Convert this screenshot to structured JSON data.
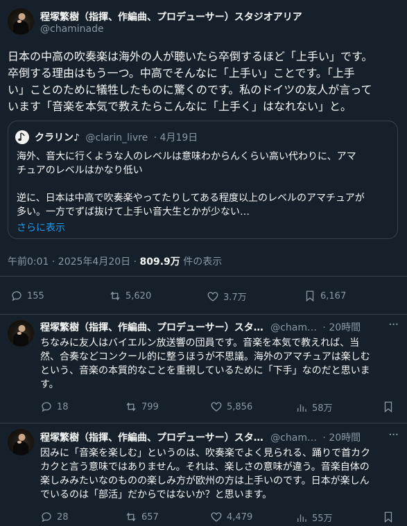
{
  "main_tweet": {
    "author_name": "程塚繁樹（指揮、作編曲、プロデューサー）スタジオアリア",
    "handle": "@chaminade",
    "lines": [
      "日本の中高の吹奏楽は海外の人が聴いたら卒倒するほど「上手い」です。",
      "卒倒する理由はもう一つ。中高でそんなに「上手い」ことです。「上手",
      "い」ことのために犠牲したものに驚くのです。私のドイツの友人が言って",
      "います「音楽を本気で教えたらこんなに「上手く」はなれない」と。"
    ],
    "quote": {
      "author_name": "クラリン♪",
      "handle": "@clarin_livre",
      "date": "· 4月19日",
      "lines": [
        "海外、音大に行くような人のレベルは意味わからんくらい高い代わりに、アマ",
        "チュアのレベルはかなり低い",
        "",
        "逆に、日本は中高で吹奏楽やってたりしてある程度以上のレベルのアマチュアが",
        "多い。一方でずば抜けて上手い音大生とかが少ない…"
      ],
      "show_more": "さらに表示"
    },
    "meta": {
      "time": "午前0:01 · 2025年4月20日 · ",
      "views": "809.9万",
      "views_suffix": " 件の表示"
    },
    "actions": {
      "replies": "155",
      "retweets": "5,620",
      "likes": "3.7万",
      "bookmarks": "6,167"
    }
  },
  "replies": [
    {
      "author_name": "程塚繁樹（指揮、作編曲、プロデューサー）スタ…",
      "handle": "@cham…",
      "time": "· 20時間",
      "lines": [
        "ちなみに友人はバイエルン放送響の団員です。音楽を本気で教えれば、当",
        "然、合奏などコンクール的に整うほうが不思議。海外のアマチュアは楽しむ",
        "という、音楽の本質的なことを重視しているために「下手」なのだと思いま",
        "す。"
      ],
      "actions": {
        "replies": "18",
        "retweets": "799",
        "likes": "5,856",
        "views": "58万"
      }
    },
    {
      "author_name": "程塚繁樹（指揮、作編曲、プロデューサー）スタ…",
      "handle": "@cham…",
      "time": "· 20時間",
      "lines": [
        "因みに「音楽を楽しむ」というのは、吹奏楽でよく見られる、踊りで首カク",
        "カクと言う意味ではありません。それは、楽しさの意味が違う。音楽自体の",
        "楽しみみたいなのものの楽しみ方が欧州の方は上手いのです。日本が楽しん",
        "でいるのは「部活」だからではないか？と思います。"
      ],
      "actions": {
        "replies": "28",
        "retweets": "657",
        "likes": "4,479",
        "views": "55万"
      }
    }
  ],
  "icons": [
    "reply-icon",
    "retweet-icon",
    "like-icon",
    "views-icon",
    "bookmark-icon",
    "more-icon",
    "music-note-icon"
  ]
}
